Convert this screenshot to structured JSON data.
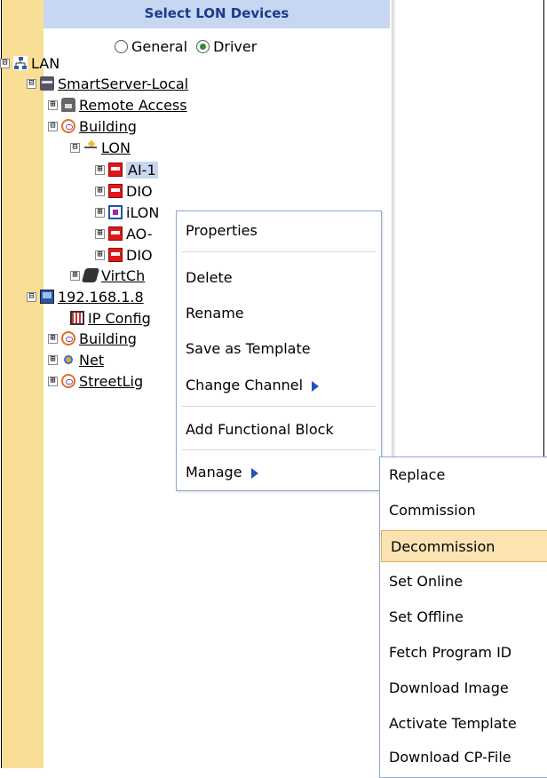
{
  "header": {
    "title": "Select LON Devices"
  },
  "mode": {
    "options": [
      "General",
      "Driver"
    ],
    "selected": "Driver"
  },
  "tree": [
    {
      "id": "lan",
      "label": "LAN",
      "expander": "⊟",
      "icon": "network-icon",
      "link": false
    },
    {
      "id": "smartserver",
      "label": "SmartServer-Local",
      "expander": "⊟",
      "icon": "server-icon",
      "link": true
    },
    {
      "id": "remote-access",
      "label": "Remote Access",
      "expander": "⊞",
      "icon": "phone-icon",
      "link": true
    },
    {
      "id": "building-1",
      "label": "Building",
      "expander": "⊟",
      "icon": "building-icon",
      "link": true
    },
    {
      "id": "lon",
      "label": "LON",
      "expander": "⊟",
      "icon": "lon-channel-icon",
      "link": true
    },
    {
      "id": "ai-1",
      "label": "AI-1",
      "expander": "⊞",
      "icon": "device-icon",
      "link": false,
      "selected": true
    },
    {
      "id": "dio-1",
      "label": "DIO",
      "expander": "⊞",
      "icon": "device-icon",
      "link": false
    },
    {
      "id": "ilon",
      "label": "iLON",
      "expander": "⊞",
      "icon": "ilon-icon",
      "link": false
    },
    {
      "id": "ao",
      "label": "AO-",
      "expander": "⊞",
      "icon": "device-icon",
      "link": false
    },
    {
      "id": "dio-2",
      "label": "DIO",
      "expander": "⊞",
      "icon": "device-icon",
      "link": false
    },
    {
      "id": "virtch",
      "label": "VirtCh",
      "expander": "⊞",
      "icon": "virtual-channel-icon",
      "link": true
    },
    {
      "id": "ip-node",
      "label": "192.168.1.8",
      "expander": "⊟",
      "icon": "computer-icon",
      "link": true
    },
    {
      "id": "ip-config",
      "label": "IP Config",
      "expander": "",
      "icon": "ip-config-icon",
      "link": true
    },
    {
      "id": "building-2",
      "label": "Building",
      "expander": "⊞",
      "icon": "building-icon",
      "link": true
    },
    {
      "id": "net",
      "label": "Net",
      "expander": "⊞",
      "icon": "net-icon",
      "link": true
    },
    {
      "id": "streetlig",
      "label": "StreetLig",
      "expander": "⊞",
      "icon": "building-icon",
      "link": true
    }
  ],
  "context_menu": {
    "items": [
      {
        "label": "Properties",
        "submenu": false
      },
      {
        "label": "Delete",
        "submenu": false
      },
      {
        "label": "Rename",
        "submenu": false
      },
      {
        "label": "Save as Template",
        "submenu": false
      },
      {
        "label": "Change Channel",
        "submenu": true
      },
      {
        "label": "Add Functional Block",
        "submenu": false
      },
      {
        "label": "Manage",
        "submenu": true
      }
    ]
  },
  "manage_submenu": {
    "highlighted": "Decommission",
    "items": [
      "Replace",
      "Commission",
      "Decommission",
      "Set Online",
      "Set Offline",
      "Fetch Program ID",
      "Download Image",
      "Activate Template",
      "Download CP-File"
    ]
  },
  "colors": {
    "left_strip": "#f9df95",
    "header_bg": "#c7d7f1",
    "highlight_bg": "#fbe4b2",
    "menu_border": "#8fa9d6"
  }
}
